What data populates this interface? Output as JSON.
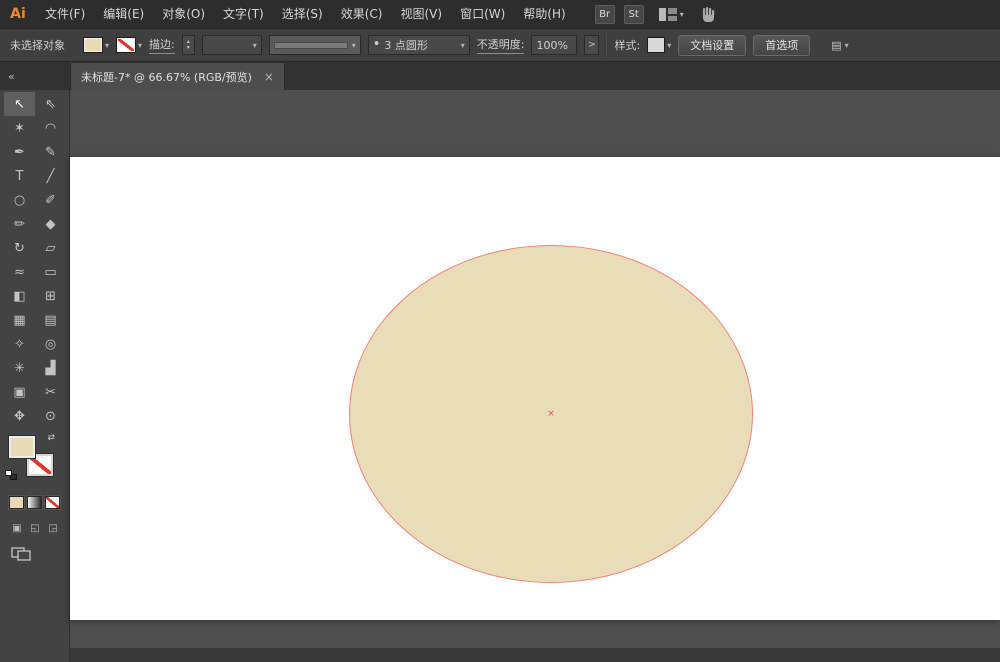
{
  "colors": {
    "fill-tan": "#e7dab4",
    "ellipse-fill": "#e9ddb9",
    "selection-red": "#f08273",
    "marker-red": "#e8493b",
    "none-red": "#e0362c"
  },
  "app": {
    "logo": "Ai"
  },
  "menubar": {
    "items": [
      "文件(F)",
      "编辑(E)",
      "对象(O)",
      "文字(T)",
      "选择(S)",
      "效果(C)",
      "视图(V)",
      "窗口(W)",
      "帮助(H)"
    ],
    "bridge_badge": "Br",
    "stock_badge": "St"
  },
  "controlbar": {
    "selection_status": "未选择对象",
    "stroke_label": "描边:",
    "brush_bullet": "•",
    "brush_name": "3 点圆形",
    "opacity_label": "不透明度:",
    "opacity_value": "100%",
    "opacity_more": ">",
    "style_label": "样式:",
    "document_setup": "文档设置",
    "preferences": "首选项"
  },
  "tabbar": {
    "collapse": "«",
    "title": "未标题-7* @ 66.67% (RGB/预览)",
    "close": "×"
  },
  "icons": {
    "dropdown": "▾",
    "stepper_up": "▴",
    "stepper_down": "▾",
    "swap": "⇄",
    "panel_flyout": "▤"
  },
  "toolbar": {
    "tools": [
      {
        "name": "selection-tool",
        "glyph": "↖",
        "active": true
      },
      {
        "name": "direct-selection-tool",
        "glyph": "⇖"
      },
      {
        "name": "magic-wand-tool",
        "glyph": "✶"
      },
      {
        "name": "lasso-tool",
        "glyph": "◠"
      },
      {
        "name": "pen-tool",
        "glyph": "✒"
      },
      {
        "name": "curvature-tool",
        "glyph": "✎"
      },
      {
        "name": "type-tool",
        "glyph": "T"
      },
      {
        "name": "line-segment-tool",
        "glyph": "╱"
      },
      {
        "name": "ellipse-tool",
        "glyph": "○"
      },
      {
        "name": "paintbrush-tool",
        "glyph": "✐"
      },
      {
        "name": "pencil-tool",
        "glyph": "✏"
      },
      {
        "name": "eraser-tool",
        "glyph": "◆"
      },
      {
        "name": "rotate-tool",
        "glyph": "↻"
      },
      {
        "name": "scale-tool",
        "glyph": "▱"
      },
      {
        "name": "width-tool",
        "glyph": "≈"
      },
      {
        "name": "free-transform-tool",
        "glyph": "▭"
      },
      {
        "name": "shape-builder-tool",
        "glyph": "◧"
      },
      {
        "name": "perspective-grid-tool",
        "glyph": "⊞"
      },
      {
        "name": "mesh-tool",
        "glyph": "▦"
      },
      {
        "name": "gradient-tool",
        "glyph": "▤"
      },
      {
        "name": "eyedropper-tool",
        "glyph": "✧"
      },
      {
        "name": "blend-tool",
        "glyph": "◎"
      },
      {
        "name": "symbol-sprayer-tool",
        "glyph": "✳"
      },
      {
        "name": "column-graph-tool",
        "glyph": "▟"
      },
      {
        "name": "artboard-tool",
        "glyph": "▣"
      },
      {
        "name": "slice-tool",
        "glyph": "✂"
      },
      {
        "name": "hand-tool",
        "glyph": "✥"
      },
      {
        "name": "zoom-tool",
        "glyph": "⊙"
      }
    ],
    "draw_modes": [
      {
        "name": "draw-normal-mode",
        "glyph": "▣"
      },
      {
        "name": "draw-behind-mode",
        "glyph": "◱"
      },
      {
        "name": "draw-inside-mode",
        "glyph": "◲"
      }
    ]
  },
  "canvas": {
    "center_marker": "×"
  }
}
